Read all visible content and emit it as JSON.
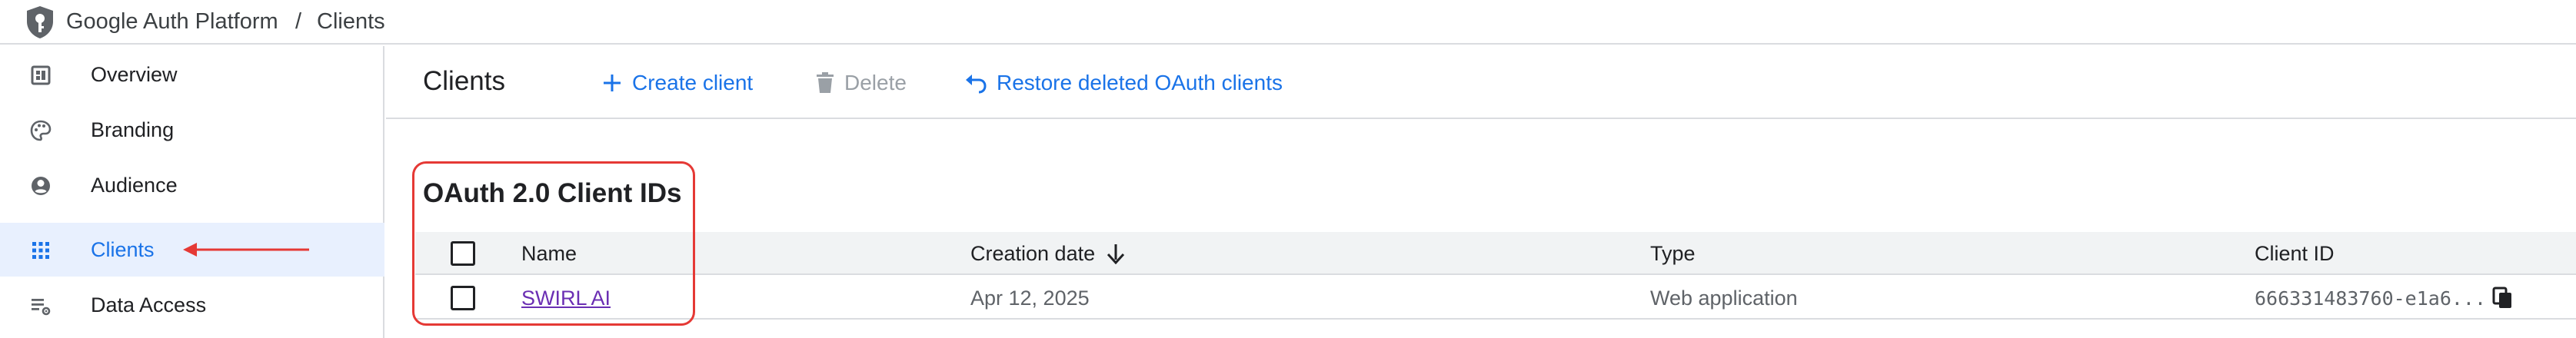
{
  "breadcrumb": {
    "app": "Google Auth Platform",
    "separator": "/",
    "page": "Clients"
  },
  "sidebar": {
    "items": [
      {
        "label": "Overview",
        "icon": "dashboard-icon",
        "active": false
      },
      {
        "label": "Branding",
        "icon": "palette-icon",
        "active": false
      },
      {
        "label": "Audience",
        "icon": "account-circle-icon",
        "active": false
      },
      {
        "label": "Clients",
        "icon": "apps-grid-icon",
        "active": true
      },
      {
        "label": "Data Access",
        "icon": "list-settings-icon",
        "active": false
      }
    ]
  },
  "header": {
    "title": "Clients",
    "actions": {
      "create": "Create client",
      "delete": "Delete",
      "restore": "Restore deleted OAuth clients"
    }
  },
  "section": {
    "title": "OAuth 2.0 Client IDs"
  },
  "table": {
    "columns": [
      "Name",
      "Creation date",
      "Type",
      "Client ID"
    ],
    "sort_column": "Creation date",
    "sort_direction": "descending",
    "rows": [
      {
        "name": "SWIRL AI",
        "creation_date": "Apr 12, 2025",
        "type": "Web application",
        "client_id": "666331483760-e1a6..."
      }
    ]
  },
  "colors": {
    "accent": "#1a73e8",
    "active_bg": "#e8f0fe",
    "disabled": "#9aa0a6",
    "annotation": "#e53935",
    "visited_link": "#6b2fb3"
  }
}
